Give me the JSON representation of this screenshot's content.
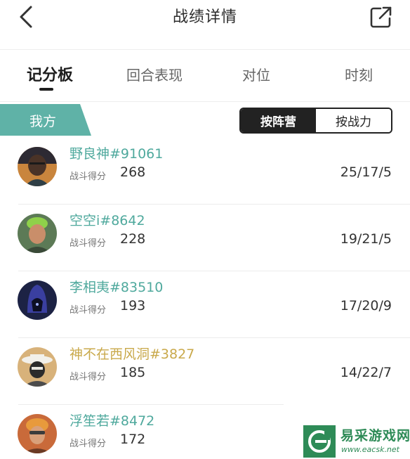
{
  "header": {
    "title": "战绩详情"
  },
  "tabs": [
    {
      "label": "记分板",
      "active": true
    },
    {
      "label": "回合表现",
      "active": false
    },
    {
      "label": "对位",
      "active": false
    },
    {
      "label": "时刻",
      "active": false
    }
  ],
  "team": {
    "label": "我方",
    "color": "#5fb2a7"
  },
  "toggle": {
    "option1": "按阵营",
    "option2": "按战力",
    "selected": "按阵营"
  },
  "players": [
    {
      "name": "野良神#91061",
      "score_label": "战斗得分",
      "score": "268",
      "kda": "25/17/5",
      "name_color": "#4fa99d"
    },
    {
      "name": "空空i#8642",
      "score_label": "战斗得分",
      "score": "228",
      "kda": "19/21/5",
      "name_color": "#4fa99d"
    },
    {
      "name": "李相夷#83510",
      "score_label": "战斗得分",
      "score": "193",
      "kda": "17/20/9",
      "name_color": "#4fa99d"
    },
    {
      "name": "神不在西风洞#3827",
      "score_label": "战斗得分",
      "score": "185",
      "kda": "14/22/7",
      "name_color": "#c9a94b"
    },
    {
      "name": "浮笙若#8472",
      "score_label": "战斗得分",
      "score": "172",
      "kda": "",
      "name_color": "#4fa99d"
    }
  ],
  "watermark": {
    "name": "易采游戏网",
    "url": "www.eacsk.net",
    "color": "#2e8b57"
  }
}
